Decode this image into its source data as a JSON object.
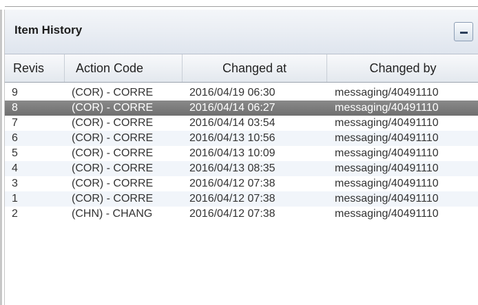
{
  "panel": {
    "title": "Item History"
  },
  "columns": {
    "revision": "Revis",
    "action_code": "Action Code",
    "changed_at": "Changed at",
    "changed_by": "Changed by"
  },
  "rows": [
    {
      "revision": "9",
      "action_code": "(COR) - CORRE",
      "changed_at": "2016/04/19 06:30",
      "changed_by": "messaging/40491110",
      "selected": false
    },
    {
      "revision": "8",
      "action_code": "(COR) - CORRE",
      "changed_at": "2016/04/14 06:27",
      "changed_by": "messaging/40491110",
      "selected": true
    },
    {
      "revision": "7",
      "action_code": "(COR) - CORRE",
      "changed_at": "2016/04/14 03:54",
      "changed_by": "messaging/40491110",
      "selected": false
    },
    {
      "revision": "6",
      "action_code": "(COR) - CORRE",
      "changed_at": "2016/04/13 10:56",
      "changed_by": "messaging/40491110",
      "selected": false
    },
    {
      "revision": "5",
      "action_code": "(COR) - CORRE",
      "changed_at": "2016/04/13 10:09",
      "changed_by": "messaging/40491110",
      "selected": false
    },
    {
      "revision": "4",
      "action_code": "(COR) - CORRE",
      "changed_at": "2016/04/13 08:35",
      "changed_by": "messaging/40491110",
      "selected": false
    },
    {
      "revision": "3",
      "action_code": "(COR) - CORRE",
      "changed_at": "2016/04/12 07:38",
      "changed_by": "messaging/40491110",
      "selected": false
    },
    {
      "revision": "1",
      "action_code": "(COR) - CORRE",
      "changed_at": "2016/04/12 07:38",
      "changed_by": "messaging/40491110",
      "selected": false
    },
    {
      "revision": "2",
      "action_code": "(CHN) - CHANG",
      "changed_at": "2016/04/12 07:38",
      "changed_by": "messaging/40491110",
      "selected": false
    }
  ],
  "icons": {
    "collapse": "minus-icon"
  },
  "colors": {
    "selected_row": "#7c7c7c",
    "alt_row": "#f1f5fa",
    "header_gradient_top": "#f4f6f9",
    "header_gradient_bottom": "#dfe5ee"
  }
}
